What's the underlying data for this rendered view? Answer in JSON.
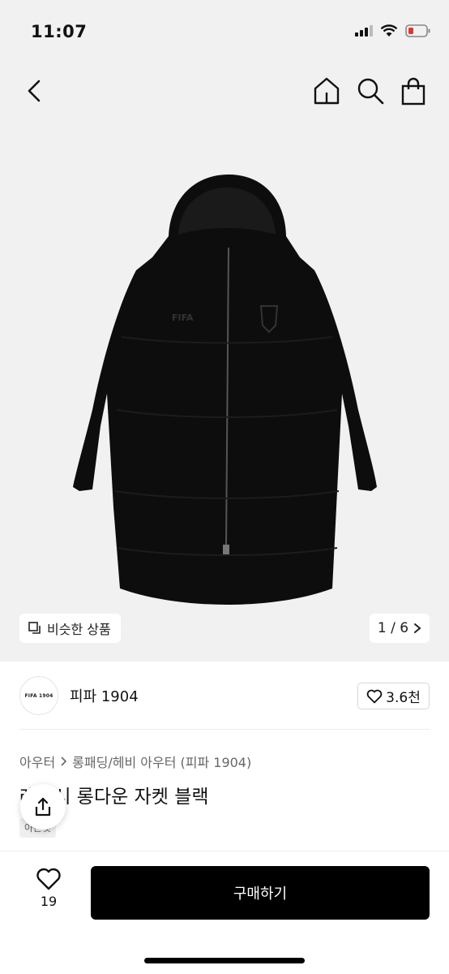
{
  "status": {
    "time": "11:07"
  },
  "product": {
    "similar_label": "비슷한 상품",
    "pager": "1 / 6",
    "brand_logo_text": "FIFA 1904",
    "brand_name": "피파 1904",
    "like_count": "3.6천",
    "breadcrumb": [
      "아우터",
      "롱패딩/헤비 아우터 (피파 1904)"
    ],
    "title": "레거시 롱다운 자켓 블랙",
    "tag": "아는것"
  },
  "bottom": {
    "wish_count": "19",
    "buy_label": "구매하기"
  },
  "icons": {
    "back": "chevron-left-icon",
    "home": "home-icon",
    "search": "search-icon",
    "bag": "shopping-bag-icon",
    "share": "share-icon",
    "heart": "heart-icon"
  }
}
